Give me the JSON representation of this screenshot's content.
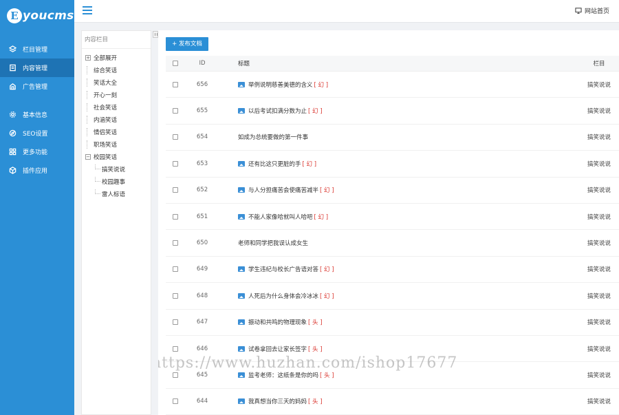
{
  "brand": {
    "mark": "E",
    "text": "youcms"
  },
  "nav": {
    "group1": [
      {
        "label": "栏目管理",
        "icon": "layers-icon"
      },
      {
        "label": "内容管理",
        "icon": "document-icon",
        "active": true
      },
      {
        "label": "广告管理",
        "icon": "ad-icon"
      }
    ],
    "group2": [
      {
        "label": "基本信息",
        "icon": "gear-icon"
      },
      {
        "label": "SEO设置",
        "icon": "compass-icon"
      },
      {
        "label": "更多功能",
        "icon": "grid-icon"
      },
      {
        "label": "插件应用",
        "icon": "cube-icon"
      }
    ]
  },
  "topbar": {
    "site_home": "网站首页"
  },
  "tree": {
    "title": "内容栏目",
    "root": "全部展开",
    "items": [
      "综合笑话",
      "笑话大全",
      "开心一刻",
      "社会笑话",
      "内涵笑话",
      "情侣笑话",
      "职场笑话"
    ],
    "expanded": "校园笑话",
    "children": [
      "搞笑说说",
      "校园趣事",
      "雷人标语"
    ]
  },
  "toolbar": {
    "add_label": "+ 发布文档"
  },
  "table": {
    "headers": {
      "id": "ID",
      "title": "标题",
      "column": "栏目"
    },
    "rows": [
      {
        "id": "656",
        "title": "举例说明慈善美德的含义",
        "flag": "[ 幻 ]",
        "has_image": true,
        "column": "搞笑说说"
      },
      {
        "id": "655",
        "title": "以后考试扣满分数为止",
        "flag": "[ 幻 ]",
        "has_image": true,
        "column": "搞笑说说"
      },
      {
        "id": "654",
        "title": "如成为总统要做的第一件事",
        "flag": "",
        "has_image": false,
        "column": "搞笑说说"
      },
      {
        "id": "653",
        "title": "还有比这只更脏的手",
        "flag": "[ 幻 ]",
        "has_image": true,
        "column": "搞笑说说"
      },
      {
        "id": "652",
        "title": "与人分担痛苦会使痛苦减半",
        "flag": "[ 幻 ]",
        "has_image": true,
        "column": "搞笑说说"
      },
      {
        "id": "651",
        "title": "不能人家像哈就叫人哈吧",
        "flag": "[ 幻 ]",
        "has_image": true,
        "column": "搞笑说说"
      },
      {
        "id": "650",
        "title": "老师和同学把我误认成女生",
        "flag": "",
        "has_image": false,
        "column": "搞笑说说"
      },
      {
        "id": "649",
        "title": "学生违纪与校长广告语对答",
        "flag": "[ 幻 ]",
        "has_image": true,
        "column": "搞笑说说"
      },
      {
        "id": "648",
        "title": "人死后为什么身体会冷冰冰",
        "flag": "[ 幻 ]",
        "has_image": true,
        "column": "搞笑说说"
      },
      {
        "id": "647",
        "title": "振动和共鸣的物理现象",
        "flag": "[ 头 ]",
        "has_image": true,
        "column": "搞笑说说"
      },
      {
        "id": "646",
        "title": "试卷拿回去让家长签字",
        "flag": "[ 头 ]",
        "has_image": true,
        "column": "搞笑说说"
      },
      {
        "id": "645",
        "title": "监考老师：这纸条是你的吗",
        "flag": "[ 头 ]",
        "has_image": true,
        "column": "搞笑说说"
      },
      {
        "id": "644",
        "title": "我真想当你三天的妈妈",
        "flag": "[ 头 ]",
        "has_image": true,
        "column": "搞笑说说"
      }
    ]
  },
  "watermark": "https://www.huzhan.com/ishop17677",
  "colors": {
    "primary": "#2b8fd6",
    "active_nav": "#1e73b4",
    "flag": "#d9322b"
  }
}
